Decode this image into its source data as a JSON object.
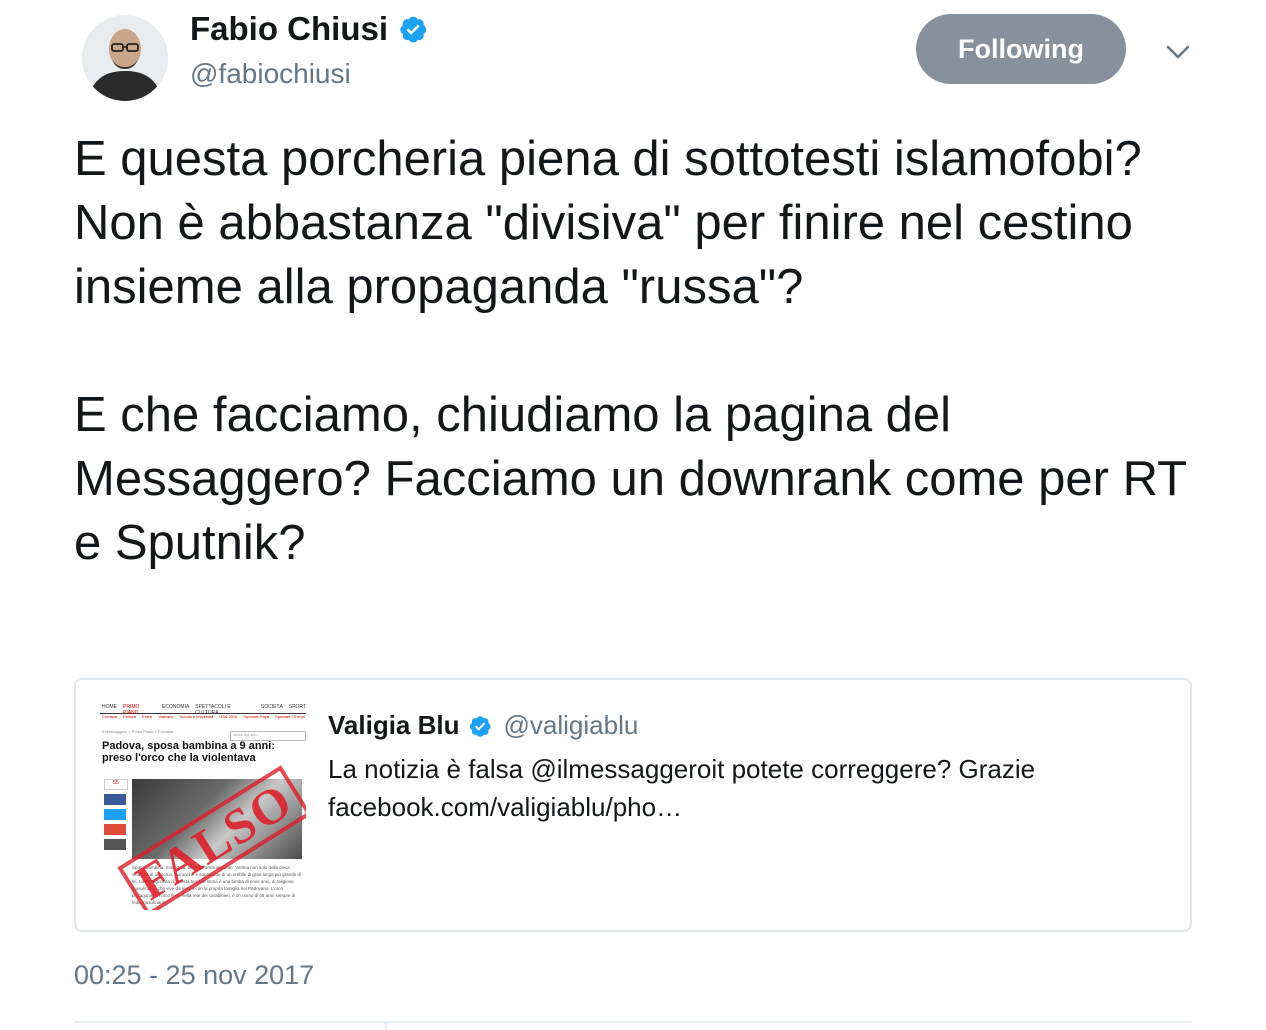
{
  "author": {
    "name": "Fabio Chiusi",
    "handle": "@fabiochiusi",
    "verified": true
  },
  "follow_button": {
    "label": "Following",
    "color": "#86919b"
  },
  "tweet": {
    "paragraphs": [
      "E questa porcheria piena di sottotesti islamofobi? Non è abbastanza \"divisiva\" per finire nel cestino insieme alla propaganda \"russa\"?",
      "E che facciamo, chiudiamo la pagina del Messaggero? Facciamo un downrank come per RT e Sputnik?"
    ],
    "timestamp": "00:25 - 25 nov 2017"
  },
  "quoted_tweet": {
    "name": "Valigia Blu",
    "handle": "@valigiablu",
    "verified": true,
    "text": "La notizia è falsa @ilmessaggeroit potete correggere? Grazie facebook.com/valigiablu/pho…",
    "thumbnail": {
      "nav": [
        "HOME",
        "PRIMO PIANO",
        "ECONOMIA",
        "SPETTACOLI E CULTURA",
        "SOCIETÀ",
        "SPORT"
      ],
      "subnav": [
        "Cronaca",
        "Politica",
        "Esteri",
        "Vaticano",
        "Scuola e università",
        "USA 2016",
        "Speciale Papa",
        "Speciale 70 anni"
      ],
      "breadcrumb": "Il Messaggero > Primo Piano > Cronaca",
      "search_placeholder": "cerca nel sito...",
      "headline": "Padova, sposa bambina a 9 anni: preso l'orco che la violentava",
      "share_count": "55",
      "stamp": "FALSO",
      "body": "Sposa bambina, molestata, abusata sessualmente. Vittima non solo della cieca violenza di un uomo, ma anche e soprattutto di un orribile di gran lunga più grande di lei. La protagonista di questa terribile storia è una bimba di nove anni, di religione musulmana, che vive da tempo con la propria famiglia nel Padovano. L'orco protagonista, l'orco finito nella rete dei carabinieri, è un uomo di 35 anni sempre di fede musulmana."
    }
  },
  "colors": {
    "verified_blue": "#1da1f2",
    "text": "#14171a",
    "secondary_text": "#657786",
    "border": "#e1e8ed"
  },
  "icons": {
    "verified": "verified-badge-icon",
    "menu": "chevron-down-icon"
  }
}
